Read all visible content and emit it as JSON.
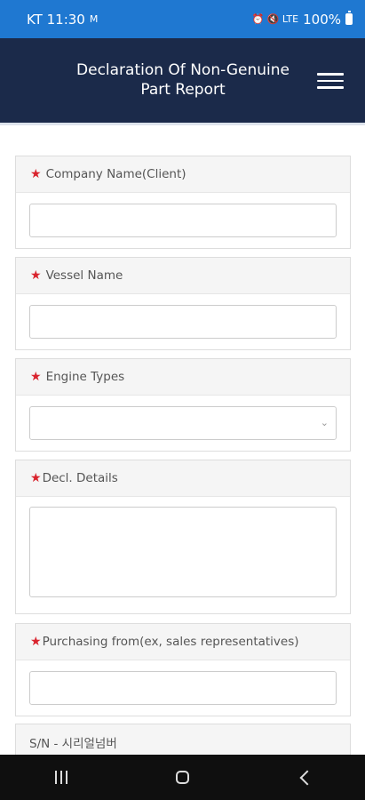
{
  "status_bar": {
    "carrier_time": "KT 11:30",
    "left_icon": "M",
    "right_icons": "⏰ 🔇 LTE",
    "battery": "100%"
  },
  "header": {
    "title": "Declaration Of Non-Genuine Part Report"
  },
  "form": {
    "required_mark": "★",
    "company_label": "Company Name(Client)",
    "company_value": "",
    "vessel_label": "Vessel Name",
    "vessel_value": "",
    "engine_label": "Engine Types",
    "engine_selected": "",
    "details_label": "Decl. Details",
    "details_value": "",
    "purchasing_label": "Purchasing from(ex, sales representatives)",
    "purchasing_value": "",
    "sn_label": "S/N - 시리얼넘버"
  }
}
